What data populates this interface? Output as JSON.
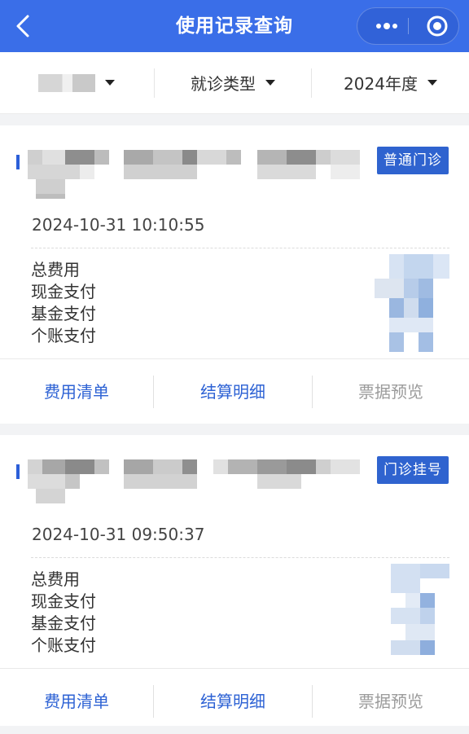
{
  "header": {
    "title": "使用记录查询",
    "back_icon": "chevron-left-icon",
    "more_icon": "more-dots-icon",
    "target_icon": "target-icon"
  },
  "filters": {
    "patient_caret": "caret-down-icon",
    "visit_type": "就诊类型",
    "year": "2024年度"
  },
  "records": [
    {
      "tag": "普通门诊",
      "datetime": "2024-10-31 10:10:55",
      "fees": [
        "总费用",
        "现金支付",
        "基金支付",
        "个账支付"
      ],
      "actions": [
        "费用清单",
        "结算明细",
        "票据预览"
      ]
    },
    {
      "tag": "门诊挂号",
      "datetime": "2024-10-31 09:50:37",
      "fees": [
        "总费用",
        "现金支付",
        "基金支付",
        "个账支付"
      ],
      "actions": [
        "费用清单",
        "结算明细",
        "票据预览"
      ]
    }
  ],
  "colors": {
    "header_bg": "#3a6ee8",
    "accent": "#2c5fd8",
    "tag_bg": "#2f63cf",
    "action_active": "#2d62d4",
    "action_disabled": "#9b9b9b"
  }
}
